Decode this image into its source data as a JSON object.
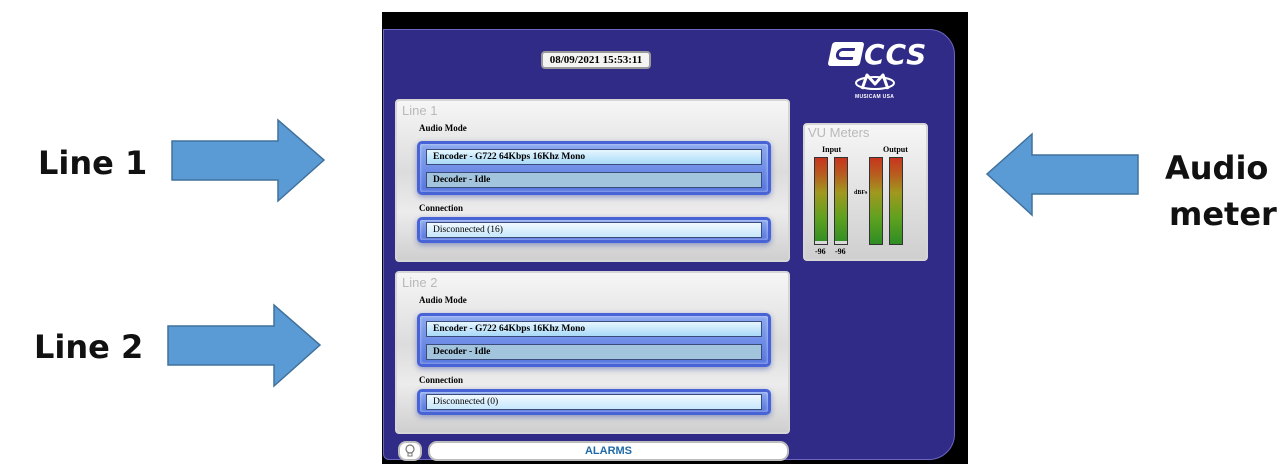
{
  "callouts": {
    "line1": "Line 1",
    "line2": "Line 2",
    "audio": "Audio",
    "meter": "meter"
  },
  "device": {
    "datetime": "08/09/2021 15:53:11",
    "logo": {
      "brand": "CCS",
      "tagline": "MUSICAM USA"
    },
    "lines": [
      {
        "title": "Line 1",
        "audio_mode_label": "Audio Mode",
        "encoder": "Encoder -  G722 64Kbps 16Khz Mono",
        "decoder": "Decoder -  Idle",
        "connection_label": "Connection",
        "connection_status": "Disconnected (16)"
      },
      {
        "title": "Line 2",
        "audio_mode_label": "Audio Mode",
        "encoder": "Encoder -  G722 64Kbps 16Khz Mono",
        "decoder": "Decoder -  Idle",
        "connection_label": "Connection",
        "connection_status": "Disconnected (0)"
      }
    ],
    "vu_meters": {
      "title": "VU Meters",
      "input_label": "Input",
      "output_label": "Output",
      "unit": "dBFs",
      "input_left": "-96",
      "input_right": "-96"
    },
    "alarms_label": "ALARMS",
    "alarm_icon": "lightbulb-icon"
  },
  "colors": {
    "panel": "#302b86",
    "arrow": "#5b9bd5",
    "alarm_text": "#1f6aa8"
  }
}
